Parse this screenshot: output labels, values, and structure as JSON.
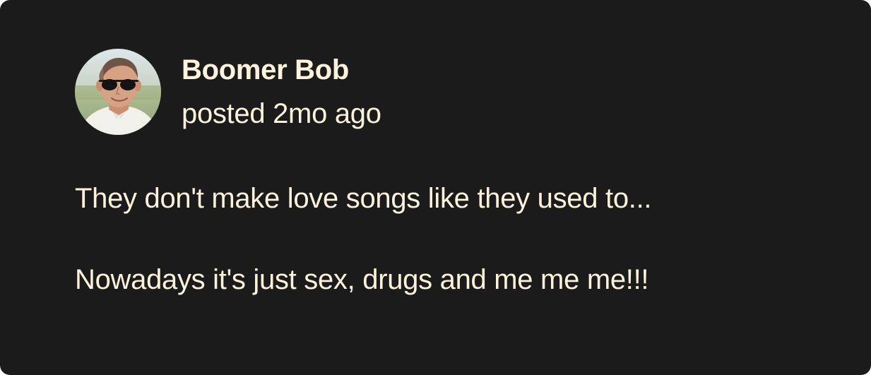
{
  "colors": {
    "card_background": "#1b1b1b",
    "text": "#fdf3dc"
  },
  "post": {
    "author": "Boomer Bob",
    "timestamp": "posted 2mo ago",
    "avatar_icon": "user-avatar-photo",
    "paragraphs": [
      "They don't make love songs like they used to...",
      "Nowadays it's just sex, drugs and me me me!!!"
    ]
  }
}
